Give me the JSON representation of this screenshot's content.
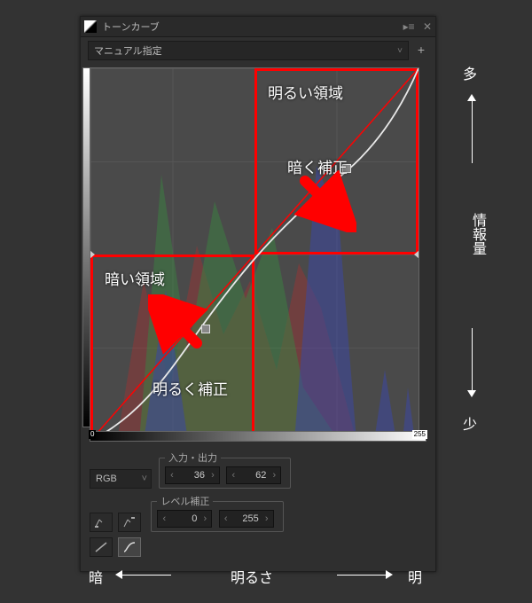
{
  "panel": {
    "title": "トーンカーブ",
    "preset_label": "マニュアル指定"
  },
  "graph": {
    "min": "0",
    "max": "255",
    "annotation": {
      "bright_region": "明るい領域",
      "dark_region": "暗い領域",
      "darken_correction": "暗く補正",
      "brighten_correction": "明るく補正"
    }
  },
  "controls": {
    "channel": "RGB",
    "io_group_label": "入力・出力",
    "input_value": "36",
    "output_value": "62",
    "level_group_label": "レベル補正",
    "level_low": "0",
    "level_high": "255"
  },
  "outer": {
    "more": "多",
    "less": "少",
    "info_amount": "情報量",
    "brightness": "明るさ",
    "dark": "暗",
    "bright": "明"
  }
}
